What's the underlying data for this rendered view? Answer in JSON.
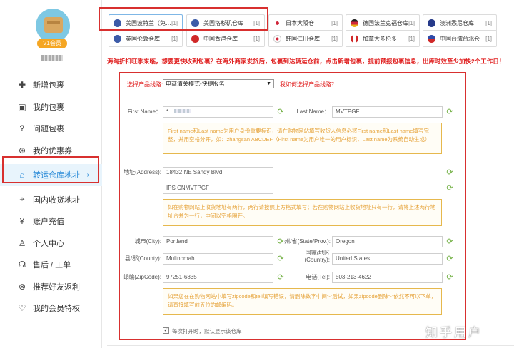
{
  "user": {
    "badge": "V1会员",
    "name": "H♀♂"
  },
  "nav": [
    {
      "label": "新增包裹",
      "icon": "plus-icon"
    },
    {
      "label": "我的包裹",
      "icon": "package-icon"
    },
    {
      "label": "问题包裹",
      "icon": "question-icon"
    },
    {
      "label": "我的优惠券",
      "icon": "coupon-icon"
    },
    {
      "label": "转运仓库地址",
      "icon": "home-icon",
      "chevron": "›"
    },
    {
      "label": "国内收货地址",
      "icon": "location-pin-icon"
    },
    {
      "label": "账户充值",
      "icon": "yen-icon"
    },
    {
      "label": "个人中心",
      "icon": "user-icon"
    },
    {
      "label": "售后 / 工单",
      "icon": "headset-icon"
    },
    {
      "label": "推荐好友返利",
      "icon": "share-icon"
    },
    {
      "label": "我的会员特权",
      "icon": "heart-icon"
    }
  ],
  "tabs": [
    {
      "label": "美国波特兰（免…",
      "count": "[1]",
      "flag_color": "#3c5ba8"
    },
    {
      "label": "美国洛杉矶仓库",
      "count": "[1]",
      "flag_color": "#3c5ba8"
    },
    {
      "label": "日本大阪仓",
      "count": "[1]",
      "flag_color": "#d0263a"
    },
    {
      "label": "德国法兰克福仓库",
      "count": "[1]",
      "flag_color": "#e8a21b"
    },
    {
      "label": "澳洲悉尼仓库",
      "count": "[1]",
      "flag_color": "#263a8a"
    },
    {
      "label": "英国伦敦仓库",
      "count": "[1]",
      "flag_color": "#3c5ba8"
    },
    {
      "label": "中国香港仓库",
      "count": "[1]",
      "flag_color": "#d02828"
    },
    {
      "label": "韩国仁川仓库",
      "count": "[1]",
      "flag_color": "#e8e8e8"
    },
    {
      "label": "加拿大多伦多",
      "count": "[1]",
      "flag_color": "#d02828"
    },
    {
      "label": "中国台湾台北仓",
      "count": "[1]",
      "flag_color": "#2f4aa8"
    }
  ],
  "notice": "海淘折扣旺季来临，想要更快收到包裹？在海外商家发货后，包裹到达转运仓前，点击新增包裹，提前预报包裹信息，出库时效至少加快2个工作日！",
  "form": {
    "route_label": "选择产品线路:",
    "route_value": "电商清关模式-快捷服务",
    "route_help": "我如何选择产品线路？",
    "first_name_label": "First Name：",
    "first_name_value": "*",
    "last_name_label": "Last Name：",
    "last_name_value": "MVTPGF",
    "name_hint": "First name和Last name为用户身份重要标识，请在购物网站填写收货人信息必将First name和Last name填写完整，并用空格分开，如：zhangsan ABCDEF（First name为用户唯一的用户标识，Last name为系统自动生成）",
    "address_label": "地址(Address):",
    "address1": "18432 NE Sandy Blvd",
    "address2": "IPS CNMVTPGF",
    "address_hint": "如在购物网站上收货地址有两行，两行请按照上方格式填写；若在购物网站上收货地址只有一行，请将上述两行地址合并为一行，中间以空格隔开。",
    "city_label": "城市(City):",
    "city_value": "Portland",
    "state_label": "州/省(State/Prov.):",
    "state_value": "Oregon",
    "county_label": "县/郡(County):",
    "county_value": "Multnomah",
    "country_label": "国家/地区(Country):",
    "country_value": "United States",
    "zip_label": "邮编(ZipCode):",
    "zip_value": "97251-6835",
    "tel_label": "电话(Tel):",
    "tel_value": "503-213-4622",
    "zip_hint": "如果您在在购物网站中填写zipcode和tell填写错误，请删除数字中间“-”后试，如果zipcode删除“-”依然不可以下单，请直接填写前五位的邮编码。",
    "checkbox_label": "每次打开时，默认显示该仓库"
  },
  "watermark": "知乎用户",
  "colors": {
    "accent": "#2a8bd8",
    "highlight": "#d8302f",
    "notice": "#e02020",
    "hint": "#e6a33a"
  }
}
